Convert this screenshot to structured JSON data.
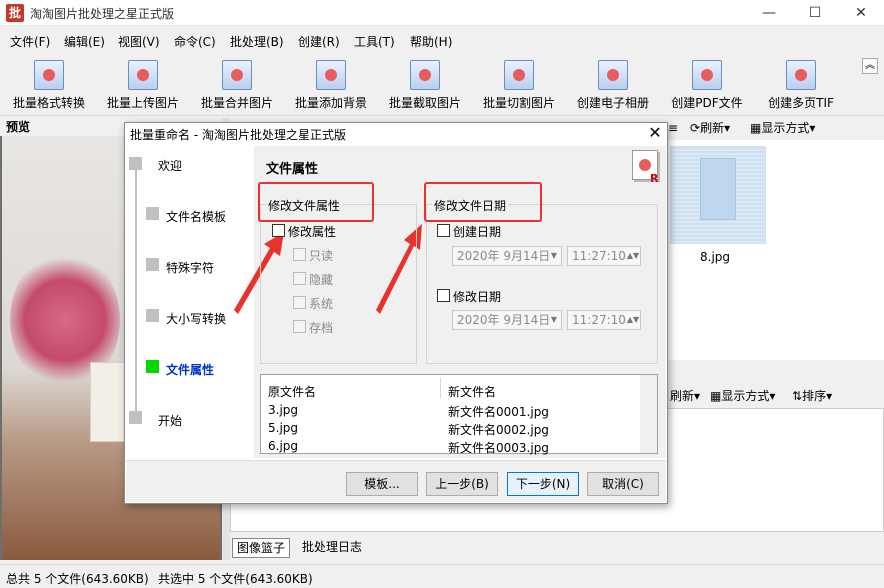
{
  "window": {
    "title": "淘淘图片批处理之星正式版",
    "logo": "批",
    "min": "—",
    "max": "☐",
    "close": "✕"
  },
  "menu": [
    "文件(F)",
    "编辑(E)",
    "视图(V)",
    "命令(C)",
    "批处理(B)",
    "创建(R)",
    "工具(T)",
    "帮助(H)"
  ],
  "toolbar": [
    "批量格式转换",
    "批量上传图片",
    "批量合并图片",
    "批量添加背景",
    "批量截取图片",
    "批量切割图片",
    "创建电子相册",
    "创建PDF文件",
    "创建多页TIF"
  ],
  "preview": {
    "header": "预览"
  },
  "right_toolbar": {
    "a": "≡",
    "refresh": "刷新",
    "display": "显示方式"
  },
  "thumb": {
    "name": "8.jpg"
  },
  "right_toolbar2": {
    "refresh": "刷新",
    "display": "显示方式",
    "sort": "排序"
  },
  "tabs": [
    "图像篮子",
    "批处理日志"
  ],
  "status": {
    "total": "总共 5 个文件(643.60KB)",
    "selected": "共选中 5 个文件(643.60KB)"
  },
  "dialog": {
    "title": "批量重命名 - 淘淘图片批处理之星正式版",
    "nav": [
      "欢迎",
      "文件名模板",
      "特殊字符",
      "大小写转换",
      "文件属性",
      "开始"
    ],
    "heading": "文件属性",
    "attr_group": "修改文件属性",
    "attr_check": "修改属性",
    "attrs": [
      "只读",
      "隐藏",
      "系统",
      "存档"
    ],
    "date_group": "修改文件日期",
    "create_date": "创建日期",
    "modify_date": "修改日期",
    "date_value": "2020年  9月14日",
    "time_value": "11:27:10",
    "list_header": [
      "原文件名",
      "新文件名"
    ],
    "rows": [
      [
        "3.jpg",
        "新文件名0001.jpg"
      ],
      [
        "5.jpg",
        "新文件名0002.jpg"
      ],
      [
        "6.jpg",
        "新文件名0003.jpg"
      ]
    ],
    "buttons": {
      "template": "模板...",
      "prev": "上一步(B)",
      "next": "下一步(N)",
      "cancel": "取消(C)"
    }
  }
}
